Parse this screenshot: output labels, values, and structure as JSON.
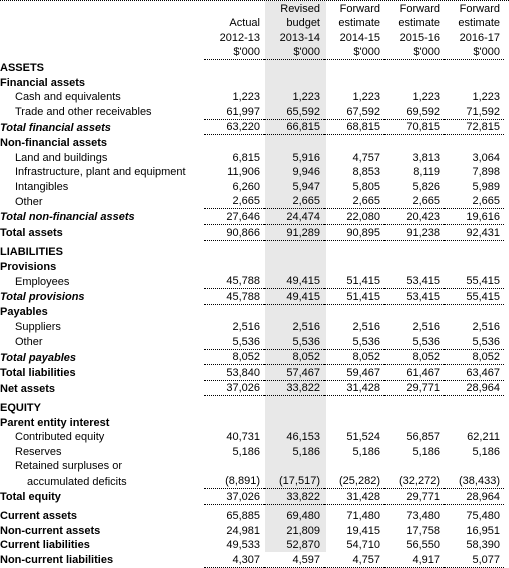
{
  "header": {
    "columns": [
      {
        "line1": "",
        "line2": "Actual",
        "line3": "2012-13",
        "line4": "$'000"
      },
      {
        "line1": "Revised",
        "line2": "budget",
        "line3": "2013-14",
        "line4": "$'000"
      },
      {
        "line1": "Forward",
        "line2": "estimate",
        "line3": "2014-15",
        "line4": "$'000"
      },
      {
        "line1": "Forward",
        "line2": "estimate",
        "line3": "2015-16",
        "line4": "$'000"
      },
      {
        "line1": "Forward",
        "line2": "estimate",
        "line3": "2016-17",
        "line4": "$'000"
      }
    ],
    "highlight_color": "#e8e8e8"
  },
  "rows": {
    "assets": {
      "label": "ASSETS"
    },
    "financial_assets": {
      "label": "Financial assets"
    },
    "cash": {
      "label": "Cash and equivalents",
      "values": [
        "1,223",
        "1,223",
        "1,223",
        "1,223",
        "1,223"
      ]
    },
    "receivables": {
      "label": "Trade and other receivables",
      "values": [
        "61,997",
        "65,592",
        "67,592",
        "69,592",
        "71,592"
      ]
    },
    "total_financial": {
      "label": "Total financial assets",
      "values": [
        "63,220",
        "66,815",
        "68,815",
        "70,815",
        "72,815"
      ]
    },
    "non_financial_assets": {
      "label": "Non-financial assets"
    },
    "land": {
      "label": "Land and buildings",
      "values": [
        "6,815",
        "5,916",
        "4,757",
        "3,813",
        "3,064"
      ]
    },
    "infrastructure": {
      "label": "Infrastructure, plant and equipment",
      "values": [
        "11,906",
        "9,946",
        "8,853",
        "8,119",
        "7,898"
      ]
    },
    "intangibles": {
      "label": "Intangibles",
      "values": [
        "6,260",
        "5,947",
        "5,805",
        "5,826",
        "5,989"
      ]
    },
    "other_nfa": {
      "label": "Other",
      "values": [
        "2,665",
        "2,665",
        "2,665",
        "2,665",
        "2,665"
      ]
    },
    "total_non_financial": {
      "label": "Total non-financial assets",
      "values": [
        "27,646",
        "24,474",
        "22,080",
        "20,423",
        "19,616"
      ]
    },
    "total_assets": {
      "label": "Total assets",
      "values": [
        "90,866",
        "91,289",
        "90,895",
        "91,238",
        "92,431"
      ]
    },
    "liabilities": {
      "label": "LIABILITIES"
    },
    "provisions": {
      "label": "Provisions"
    },
    "employees": {
      "label": "Employees",
      "values": [
        "45,788",
        "49,415",
        "51,415",
        "53,415",
        "55,415"
      ]
    },
    "total_provisions": {
      "label": "Total provisions",
      "values": [
        "45,788",
        "49,415",
        "51,415",
        "53,415",
        "55,415"
      ]
    },
    "payables": {
      "label": "Payables"
    },
    "suppliers": {
      "label": "Suppliers",
      "values": [
        "2,516",
        "2,516",
        "2,516",
        "2,516",
        "2,516"
      ]
    },
    "other_payables": {
      "label": "Other",
      "values": [
        "5,536",
        "5,536",
        "5,536",
        "5,536",
        "5,536"
      ]
    },
    "total_payables": {
      "label": "Total payables",
      "values": [
        "8,052",
        "8,052",
        "8,052",
        "8,052",
        "8,052"
      ]
    },
    "total_liabilities": {
      "label": "Total liabilities",
      "values": [
        "53,840",
        "57,467",
        "59,467",
        "61,467",
        "63,467"
      ]
    },
    "net_assets": {
      "label": "Net assets",
      "values": [
        "37,026",
        "33,822",
        "31,428",
        "29,771",
        "28,964"
      ]
    },
    "equity": {
      "label": "EQUITY"
    },
    "parent_interest": {
      "label": "Parent entity interest"
    },
    "contributed_equity": {
      "label": "Contributed equity",
      "values": [
        "40,731",
        "46,153",
        "51,524",
        "56,857",
        "62,211"
      ]
    },
    "reserves": {
      "label": "Reserves",
      "values": [
        "5,186",
        "5,186",
        "5,186",
        "5,186",
        "5,186"
      ]
    },
    "retained_line1": {
      "label": "Retained surpluses or"
    },
    "retained_line2": {
      "label": "accumulated deficits",
      "values": [
        "(8,891)",
        "(17,517)",
        "(25,282)",
        "(32,272)",
        "(38,433)"
      ]
    },
    "total_equity": {
      "label": "Total equity",
      "values": [
        "37,026",
        "33,822",
        "31,428",
        "29,771",
        "28,964"
      ]
    },
    "current_assets": {
      "label": "Current assets",
      "values": [
        "65,885",
        "69,480",
        "71,480",
        "73,480",
        "75,480"
      ]
    },
    "non_current_assets": {
      "label": "Non-current assets",
      "values": [
        "24,981",
        "21,809",
        "19,415",
        "17,758",
        "16,951"
      ]
    },
    "current_liabilities": {
      "label": "Current liabilities",
      "values": [
        "49,533",
        "52,870",
        "54,710",
        "56,550",
        "58,390"
      ]
    },
    "non_current_liabilities": {
      "label": "Non-current liabilities",
      "values": [
        "4,307",
        "4,597",
        "4,757",
        "4,917",
        "5,077"
      ]
    }
  }
}
